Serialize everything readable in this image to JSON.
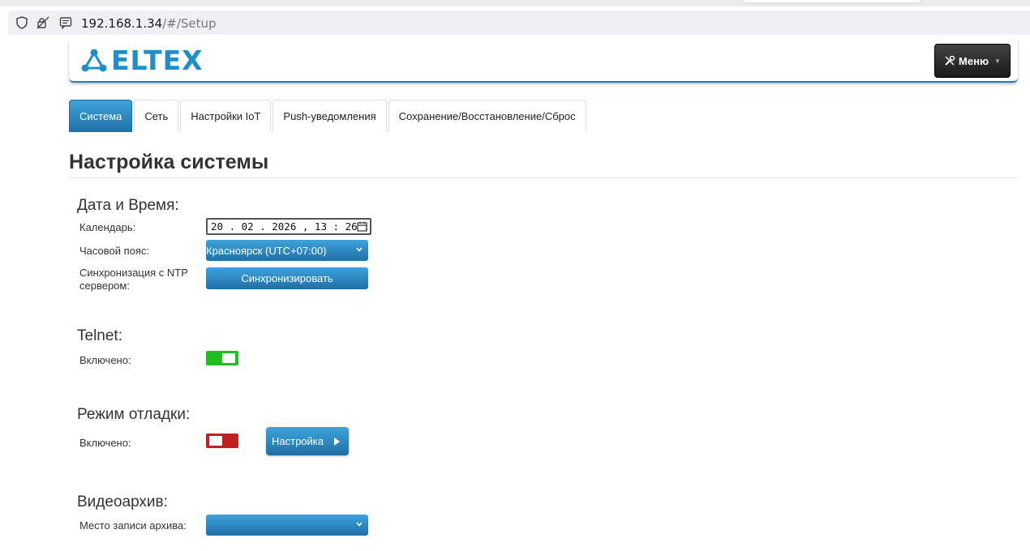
{
  "browser": {
    "url_host": "192.168.1.34",
    "url_path": "/#/Setup"
  },
  "header": {
    "logo_text": "ELTEX",
    "menu_label": "Меню"
  },
  "tabs": [
    {
      "label": "Система",
      "active": true
    },
    {
      "label": "Сеть",
      "active": false
    },
    {
      "label": "Настройки IoT",
      "active": false
    },
    {
      "label": "Push-уведомления",
      "active": false
    },
    {
      "label": "Сохранение/Восстановление/Сброс",
      "active": false
    }
  ],
  "page_title": "Настройка системы",
  "datetime": {
    "section_title": "Дата и Время:",
    "calendar_label": "Календарь:",
    "calendar_value": "20 . 02 . 2026 ,  13 : 26 : ",
    "timezone_label": "Часовой пояс:",
    "timezone_value": "Красноярск (UTC+07:00)",
    "ntp_label": "Синхронизация с NTP сервером:",
    "sync_button": "Синхронизировать"
  },
  "telnet": {
    "section_title": "Telnet:",
    "enabled_label": "Включено:",
    "enabled": true
  },
  "debug": {
    "section_title": "Режим отладки:",
    "enabled_label": "Включено:",
    "enabled": false,
    "setup_button": "Настройка"
  },
  "archive": {
    "section_title": "Видеоархив:",
    "location_label": "Место записи архива:",
    "location_value": ""
  },
  "colors": {
    "accent_blue": "#1f6fa6",
    "toggle_on": "#1fbf1f",
    "toggle_off": "#c22020"
  }
}
